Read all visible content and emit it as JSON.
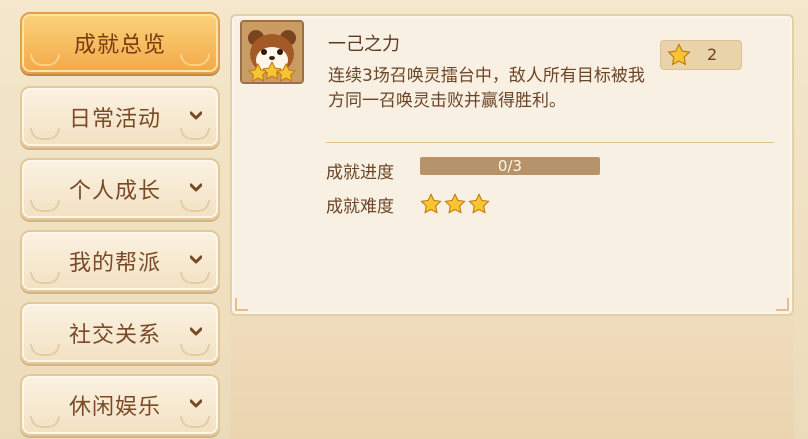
{
  "sidebar": {
    "items": [
      {
        "label": "成就总览",
        "active": true
      },
      {
        "label": "日常活动",
        "active": false
      },
      {
        "label": "个人成长",
        "active": false
      },
      {
        "label": "我的帮派",
        "active": false
      },
      {
        "label": "社交关系",
        "active": false
      },
      {
        "label": "休闲娱乐",
        "active": false
      }
    ]
  },
  "achievement": {
    "icon": "hamster-with-stars-icon",
    "title": "一己之力",
    "description": "连续3场召唤灵擂台中，敌人所有目标被我方同一召唤灵击败并赢得胜利。",
    "reward_icon": "star-icon",
    "reward_count": "2",
    "progress_label": "成就进度",
    "progress_text": "0/3",
    "progress_fraction": 0,
    "difficulty_label": "成就难度",
    "difficulty_stars": 3
  },
  "colors": {
    "active_tab": "#f2a94a",
    "tab": "#f2e1c2",
    "panel": "#f8f0e2",
    "text": "#6b4528",
    "star": "#f7c531"
  }
}
